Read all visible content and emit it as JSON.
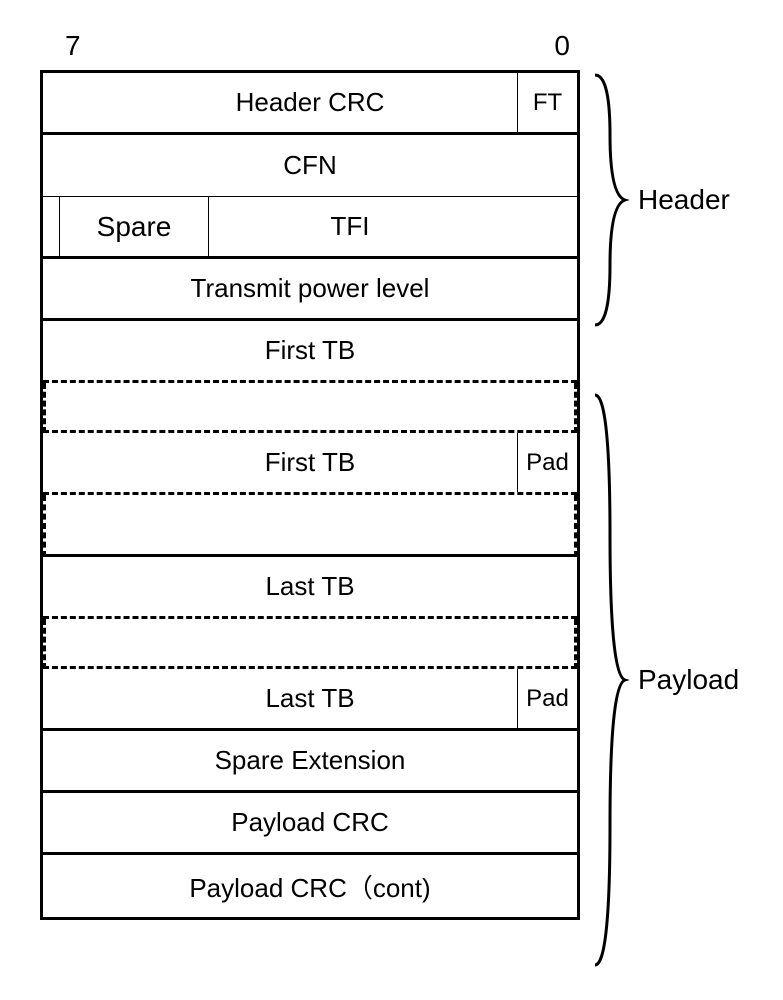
{
  "bit_labels": {
    "msb": "7",
    "lsb": "0"
  },
  "rows": {
    "header_crc": "Header CRC",
    "ft": "FT",
    "cfn": "CFN",
    "spare": "Spare",
    "tfi": "TFI",
    "tx_power": "Transmit power level",
    "first_tb": "First TB",
    "first_tb2": "First TB",
    "pad1": "Pad",
    "last_tb": "Last TB",
    "last_tb2": "Last TB",
    "pad2": "Pad",
    "spare_ext": "Spare Extension",
    "payload_crc": "Payload CRC",
    "payload_crc_cont": "Payload CRC（cont)"
  },
  "sections": {
    "header": "Header",
    "payload": "Payload"
  }
}
